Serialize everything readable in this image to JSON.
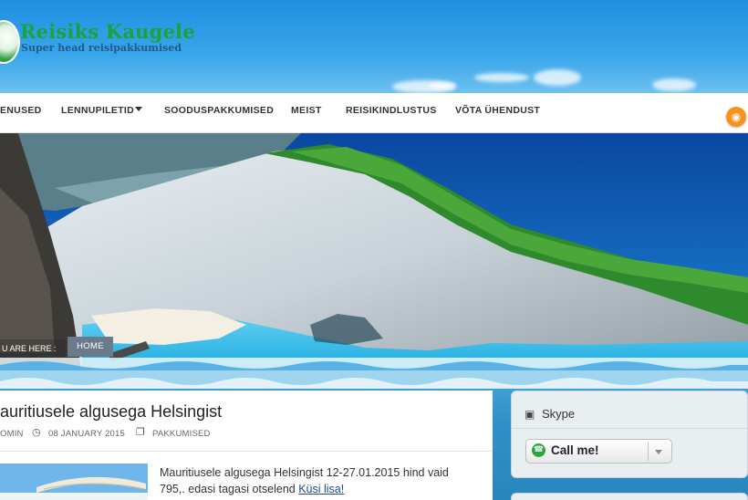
{
  "site": {
    "title": "Reisiks Kaugele",
    "tagline": "Super head reisipakkumised"
  },
  "nav": {
    "items": [
      {
        "label": "ENUSED"
      },
      {
        "label": "LENNUPILETID",
        "has_dropdown": true
      },
      {
        "label": "SOODUSPAKKUMISED"
      },
      {
        "label": "MEIST"
      },
      {
        "label": "REISIKINDLUSTUS"
      },
      {
        "label": "VÕTA ÜHENDUST"
      }
    ],
    "rss_icon": "rss-icon"
  },
  "breadcrumb": {
    "prefix": "U ARE HERE :",
    "home": "HOME"
  },
  "article": {
    "title": "auritiusele algusega Helsingist",
    "author": "OMIN",
    "date": "08 JANUARY 2015",
    "category": "PAKKUMISED",
    "excerpt": "Mauritiusele algusega Helsingist 12-27.01.2015 hind vaid 795,. edasi tagasi otselend ",
    "read_more": "Küsi lisa!"
  },
  "sidebar": {
    "skype_widget": {
      "title": "Skype",
      "button_label": "Call me!"
    }
  },
  "colors": {
    "brand_green": "#1aa33a",
    "tagline_blue": "#1c5e8a",
    "rss_orange": "#f7931e",
    "skype_green": "#27a83c"
  }
}
